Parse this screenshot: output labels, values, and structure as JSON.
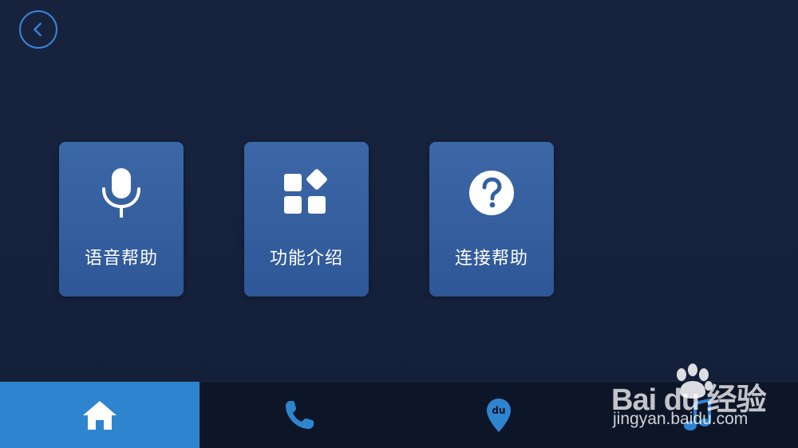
{
  "header": {
    "back_icon": "chevron-left-icon"
  },
  "cards": [
    {
      "label": "语音帮助",
      "icon": "microphone-icon"
    },
    {
      "label": "功能介绍",
      "icon": "grid-icon"
    },
    {
      "label": "连接帮助",
      "icon": "question-circle-icon"
    }
  ],
  "bottom_nav": [
    {
      "icon": "home-icon",
      "active": true
    },
    {
      "icon": "phone-icon",
      "active": false
    },
    {
      "icon": "map-pin-icon",
      "pin_text": "du",
      "active": false
    },
    {
      "icon": "music-icon",
      "active": false
    }
  ],
  "watermark": {
    "brand": "Bai du 经验",
    "url": "jingyan.baidu.com"
  },
  "colors": {
    "background": "#15213a",
    "card": "#3461a0",
    "accent": "#2f84d0",
    "nav_bar": "#0d1628"
  }
}
